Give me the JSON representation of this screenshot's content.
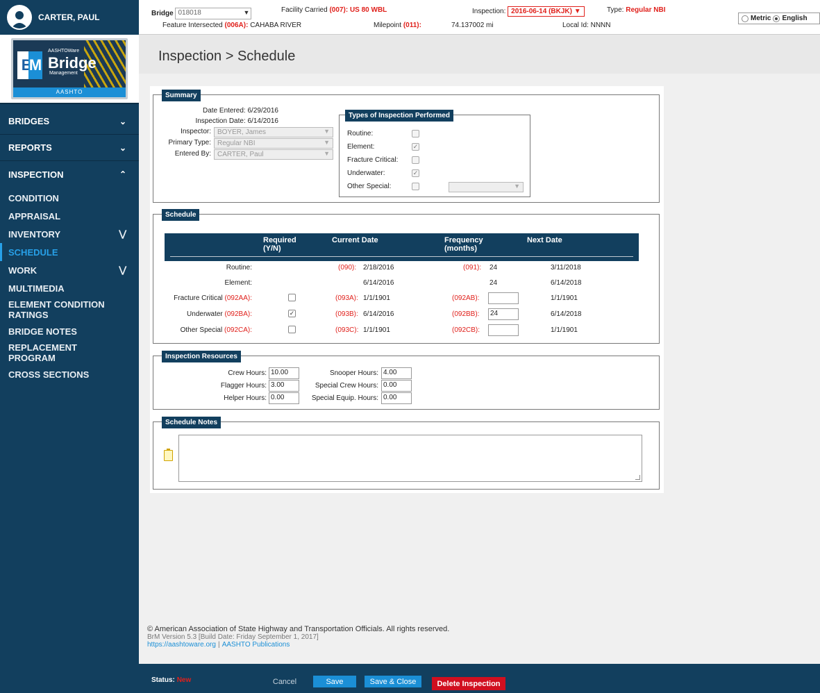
{
  "user": {
    "name": "CARTER, PAUL"
  },
  "logo": {
    "top": "AASHTOWare",
    "big": "Bridge",
    "sub": "Management",
    "foot": "AASHTO",
    "br": "Br",
    "m": "M"
  },
  "nav": {
    "sections": [
      {
        "label": "BRIDGES",
        "chevron": "chevron-down"
      },
      {
        "label": "REPORTS",
        "chevron": "chevron-down"
      },
      {
        "label": "INSPECTION",
        "chevron": "chevron-up"
      }
    ],
    "items": [
      {
        "label": "CONDITION"
      },
      {
        "label": "APPRAISAL"
      },
      {
        "label": "INVENTORY",
        "expand": "double-chevron-down"
      },
      {
        "label": "SCHEDULE",
        "active": true
      },
      {
        "label": "WORK",
        "expand": "double-chevron-down"
      },
      {
        "label": "MULTIMEDIA"
      },
      {
        "label": "ELEMENT CONDITION RATINGS"
      },
      {
        "label": "BRIDGE NOTES"
      },
      {
        "label": "REPLACEMENT PROGRAM"
      },
      {
        "label": "CROSS SECTIONS"
      }
    ]
  },
  "header": {
    "bridge_label": "Bridge",
    "bridge_value": "018018",
    "facility_label": "Facility Carried",
    "facility_code": "(007):",
    "facility_value": "US 80 WBL",
    "feature_label": "Feature Intersected",
    "feature_code": "(006A):",
    "feature_value": "CAHABA RIVER",
    "milepoint_label": "Milepoint",
    "milepoint_code": "(011):",
    "milepoint_value": "74.137002 mi",
    "inspection_label": "Inspection:",
    "inspection_value": "2016-06-14 (BKJK) ▼",
    "type_label": "Type:",
    "type_value": "Regular NBI",
    "local_label": "Local Id:",
    "local_value": "NNNN",
    "units": {
      "metric": "Metric",
      "english": "English",
      "selected": "English"
    }
  },
  "page": {
    "title": "Inspection > Schedule"
  },
  "summary": {
    "legend": "Summary",
    "date_entered_label": "Date Entered:",
    "date_entered": "6/29/2016",
    "inspection_date_label": "Inspection Date:",
    "inspection_date": "6/14/2016",
    "inspector_label": "Inspector:",
    "inspector": "BOYER, James",
    "primary_type_label": "Primary Type:",
    "primary_type": "Regular NBI",
    "entered_by_label": "Entered By:",
    "entered_by": "CARTER, Paul",
    "types_legend": "Types of Inspection Performed",
    "types": [
      {
        "label": "Routine:",
        "checked": false
      },
      {
        "label": "Element:",
        "checked": true
      },
      {
        "label": "Fracture Critical:",
        "checked": false
      },
      {
        "label": "Underwater:",
        "checked": true
      },
      {
        "label": "Other Special:",
        "checked": false
      }
    ]
  },
  "schedule": {
    "legend": "Schedule",
    "headers": {
      "required": "Required (Y/N)",
      "required_l1": "Required",
      "required_l2": "(Y/N)",
      "current": "Current Date",
      "freq_l1": "Frequency",
      "freq_l2": "(months)",
      "next": "Next Date"
    },
    "rows": [
      {
        "label": "Routine:",
        "label_code": "",
        "checkbox": null,
        "date_code": "(090):",
        "current": "2/18/2016",
        "freq_code": "(091):",
        "freq": "24",
        "freq_input": false,
        "next": "3/11/2018"
      },
      {
        "label": "Element:",
        "label_code": "",
        "checkbox": null,
        "date_code": "",
        "current": "6/14/2016",
        "freq_code": "",
        "freq": "24",
        "freq_input": false,
        "next": "6/14/2018"
      },
      {
        "label": "Fracture Critical",
        "label_code": "(092AA):",
        "checkbox": false,
        "date_code": "(093A):",
        "current": "1/1/1901",
        "freq_code": "(092AB):",
        "freq": "",
        "freq_input": true,
        "next": "1/1/1901"
      },
      {
        "label": "Underwater",
        "label_code": "(092BA):",
        "checkbox": true,
        "date_code": "(093B):",
        "current": "6/14/2016",
        "freq_code": "(092BB):",
        "freq": "24",
        "freq_input": true,
        "next": "6/14/2018"
      },
      {
        "label": "Other Special",
        "label_code": "(092CA):",
        "checkbox": false,
        "date_code": "(093C):",
        "current": "1/1/1901",
        "freq_code": "(092CB):",
        "freq": "",
        "freq_input": true,
        "next": "1/1/1901"
      }
    ]
  },
  "resources": {
    "legend": "Inspection Resources",
    "crew_label": "Crew Hours:",
    "crew": "10.00",
    "flagger_label": "Flagger Hours:",
    "flagger": "3.00",
    "helper_label": "Helper Hours:",
    "helper": "0.00",
    "snooper_label": "Snooper Hours:",
    "snooper": "4.00",
    "special_crew_label": "Special Crew Hours:",
    "special_crew": "0.00",
    "special_equip_label": "Special Equip. Hours:",
    "special_equip": "0.00"
  },
  "notes": {
    "legend": "Schedule Notes",
    "value": ""
  },
  "footer": {
    "copyright": "© American Association of State Highway and Transportation Officials. All rights reserved.",
    "version": "BrM Version 5.3 [Build Date: Friday September 1, 2017]",
    "link1": "https://aashtoware.org",
    "sep": "|",
    "link2": "AASHTO Publications"
  },
  "status": {
    "label": "Status:",
    "value": "New",
    "cancel": "Cancel",
    "save": "Save",
    "save_close": "Save & Close",
    "delete": "Delete Inspection"
  },
  "colors": {
    "navy": "#123f5e",
    "accent": "#1b8fd6",
    "red": "#e0201b",
    "delete": "#d10f1f"
  }
}
